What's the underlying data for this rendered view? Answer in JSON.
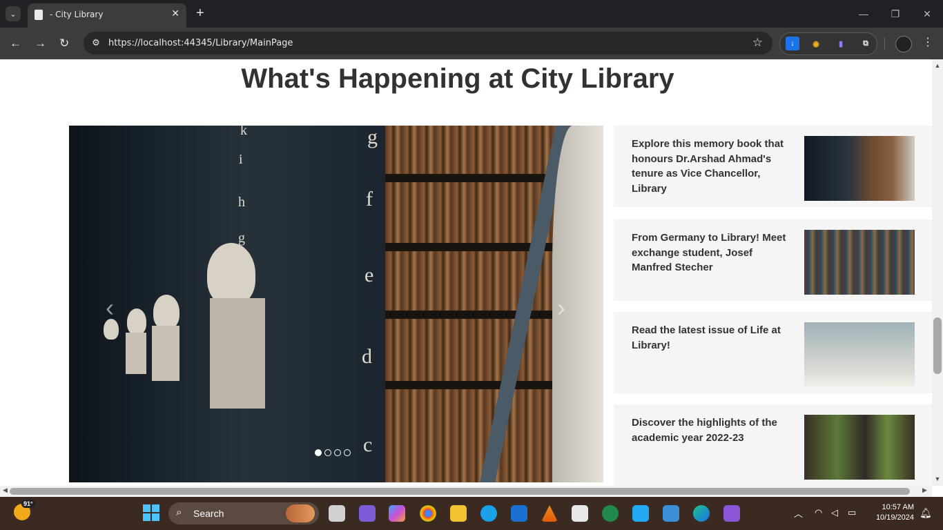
{
  "browser": {
    "tab_title": "- City Library",
    "tab_close": "✕",
    "new_tab": "+",
    "url": "https://localhost:44345/Library/MainPage",
    "window_controls": [
      "—",
      "❐",
      "✕"
    ]
  },
  "page": {
    "title": "What's Happening at City Library"
  },
  "carousel": {
    "prev_glyph": "‹",
    "next_glyph": "›",
    "indicator_count": 4,
    "active_index": 0,
    "letters": [
      "k",
      "i",
      "h",
      "g",
      "g",
      "f",
      "e",
      "d",
      "c"
    ]
  },
  "news": [
    {
      "text": "Explore this memory book that honours Dr.Arshad Ahmad's tenure as Vice Chancellor, Library"
    },
    {
      "text": "From Germany to Library! Meet exchange student, Josef Manfred Stecher"
    },
    {
      "text": "Read the latest issue of Life at Library!"
    },
    {
      "text": "Discover the highlights of the academic year 2022-23"
    }
  ],
  "taskbar": {
    "weather_temp": "91°",
    "search_label": "Search",
    "time": "10:57 AM",
    "date": "10/19/2024"
  },
  "colors": {
    "title_text": "#2f3336",
    "card_bg": "#f5f5f5",
    "chrome_dark": "#202124",
    "taskbar_bg": "#3b2a21"
  }
}
